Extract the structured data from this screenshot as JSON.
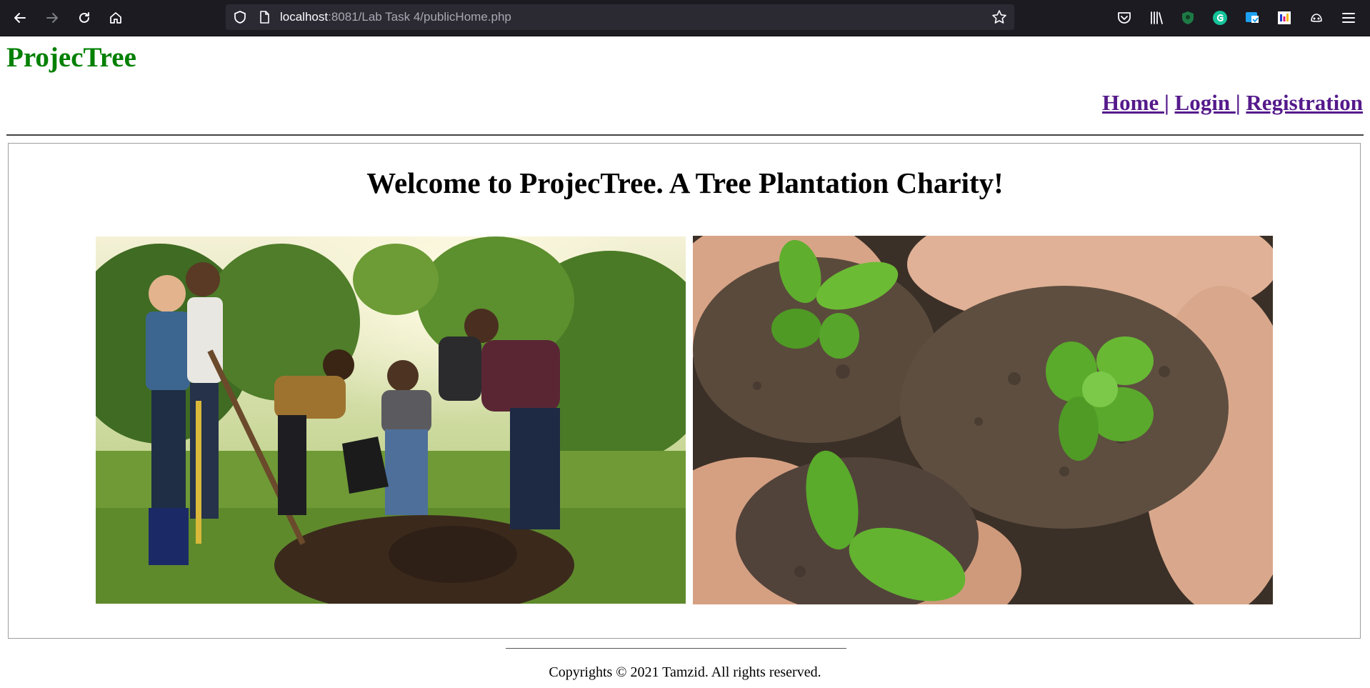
{
  "browser": {
    "url_host": "localhost",
    "url_rest": ":8081/Lab Task 4/publicHome.php",
    "icons": [
      "back-icon",
      "forward-icon",
      "reload-icon",
      "home-icon",
      "shield-icon",
      "page-icon",
      "bookmark-star-icon",
      "pocket-icon",
      "library-icon",
      "extension-shield-icon",
      "grammarly-icon",
      "extension-icon",
      "extension-color-icon",
      "extension-game-icon",
      "menu-icon"
    ]
  },
  "site": {
    "logo": "ProjecTree",
    "nav": {
      "home": "Home ",
      "login": "Login ",
      "registration": "Registration",
      "separator": "|"
    },
    "welcome": "Welcome to ProjecTree. A Tree Plantation Charity!",
    "images": [
      {
        "alt": "people planting a tree"
      },
      {
        "alt": "hands holding soil with seedlings"
      }
    ],
    "footer": "Copyrights © 2021 Tamzid. All rights reserved."
  },
  "colors": {
    "logo": "#008000",
    "link": "#551a8b",
    "chrome_bg": "#1c1b22",
    "url_bg": "#2b2a33"
  }
}
